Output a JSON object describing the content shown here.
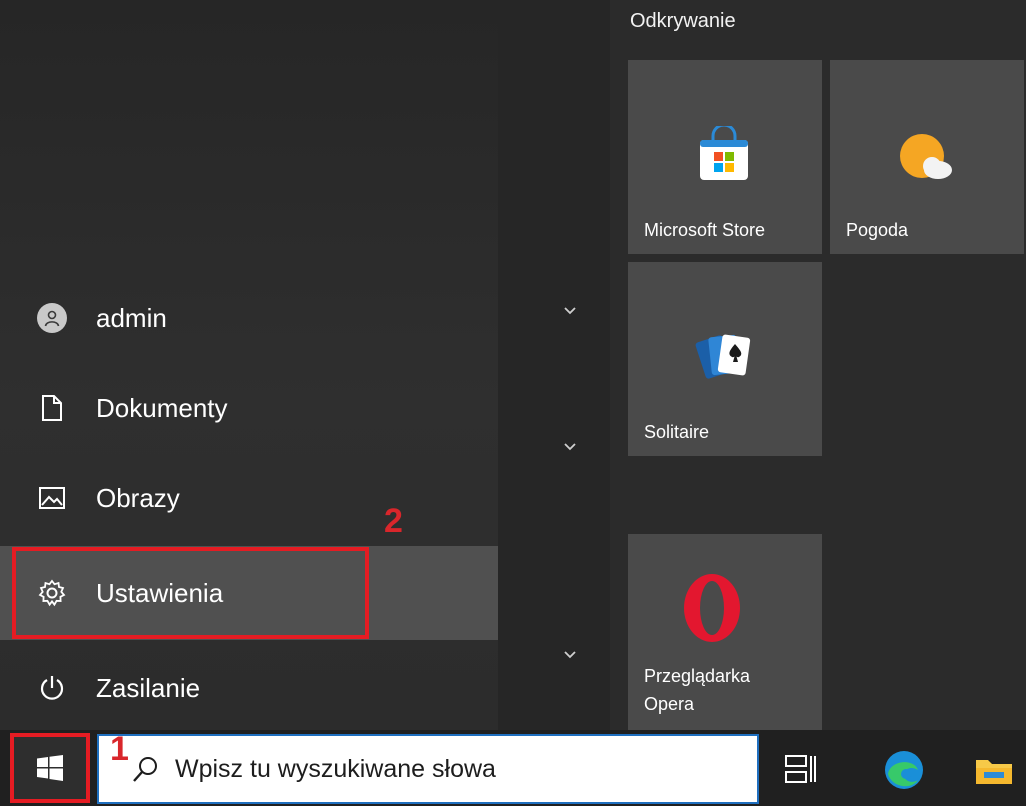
{
  "start_menu": {
    "group_title": "Odkrywanie",
    "nav": [
      {
        "label": "admin",
        "icon": "user-avatar-icon"
      },
      {
        "label": "Dokumenty",
        "icon": "document-icon"
      },
      {
        "label": "Obrazy",
        "icon": "picture-icon"
      },
      {
        "label": "Ustawienia",
        "icon": "gear-icon"
      },
      {
        "label": "Zasilanie",
        "icon": "power-icon"
      }
    ],
    "tiles": [
      {
        "label": "Microsoft Store",
        "icon": "store-bag-icon"
      },
      {
        "label": "Pogoda",
        "icon": "weather-sun-cloud-icon"
      },
      {
        "label": "Solitaire",
        "icon": "cards-icon"
      },
      {
        "label_line1": "Przeglądarka",
        "label_line2": "Opera",
        "icon": "opera-icon"
      }
    ]
  },
  "annotations": {
    "start_number": "1",
    "settings_number": "2",
    "color": "#e51c23"
  },
  "taskbar": {
    "search_placeholder": "Wpisz tu wyszukiwane słowa",
    "icons": [
      "windows-logo-icon",
      "search-icon",
      "task-view-icon",
      "edge-icon",
      "file-explorer-icon"
    ]
  }
}
